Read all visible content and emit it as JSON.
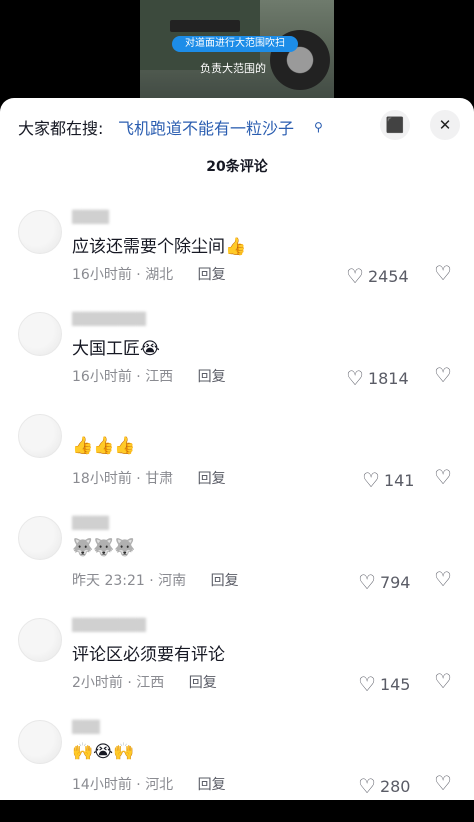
{
  "video": {
    "title": "对道面进行大范围吹扫",
    "caption": "负责大范围的"
  },
  "search": {
    "prefix": "大家都在搜:",
    "term": "飞机跑道不能有一粒沙子",
    "search_icon": "search-icon",
    "expand_icon": "expand-icon",
    "close_icon": "close-icon"
  },
  "comments_count": "20条评论",
  "comments": [
    {
      "text": "应该还需要个除尘间👍",
      "time": "16小时前",
      "location": "湖北",
      "reply": "回复",
      "likes": "2454"
    },
    {
      "text": "大国工匠😭",
      "time": "16小时前",
      "location": "江西",
      "reply": "回复",
      "likes": "1814"
    },
    {
      "text": "👍👍👍",
      "time": "18小时前",
      "location": "甘肃",
      "reply": "回复",
      "likes": "141"
    },
    {
      "text": "🐺🐺🐺",
      "time": "昨天 23:21",
      "location": "河南",
      "reply": "回复",
      "likes": "794"
    },
    {
      "text": "评论区必须要有评论",
      "time": "2小时前",
      "location": "江西",
      "reply": "回复",
      "likes": "145"
    },
    {
      "text": "🙌😭🙌",
      "time": "14小时前",
      "location": "河北",
      "reply": "回复",
      "likes": "280"
    }
  ],
  "colors": {
    "link": "#2a5db0",
    "meta": "#8a8b91",
    "background": "#ffffff"
  }
}
